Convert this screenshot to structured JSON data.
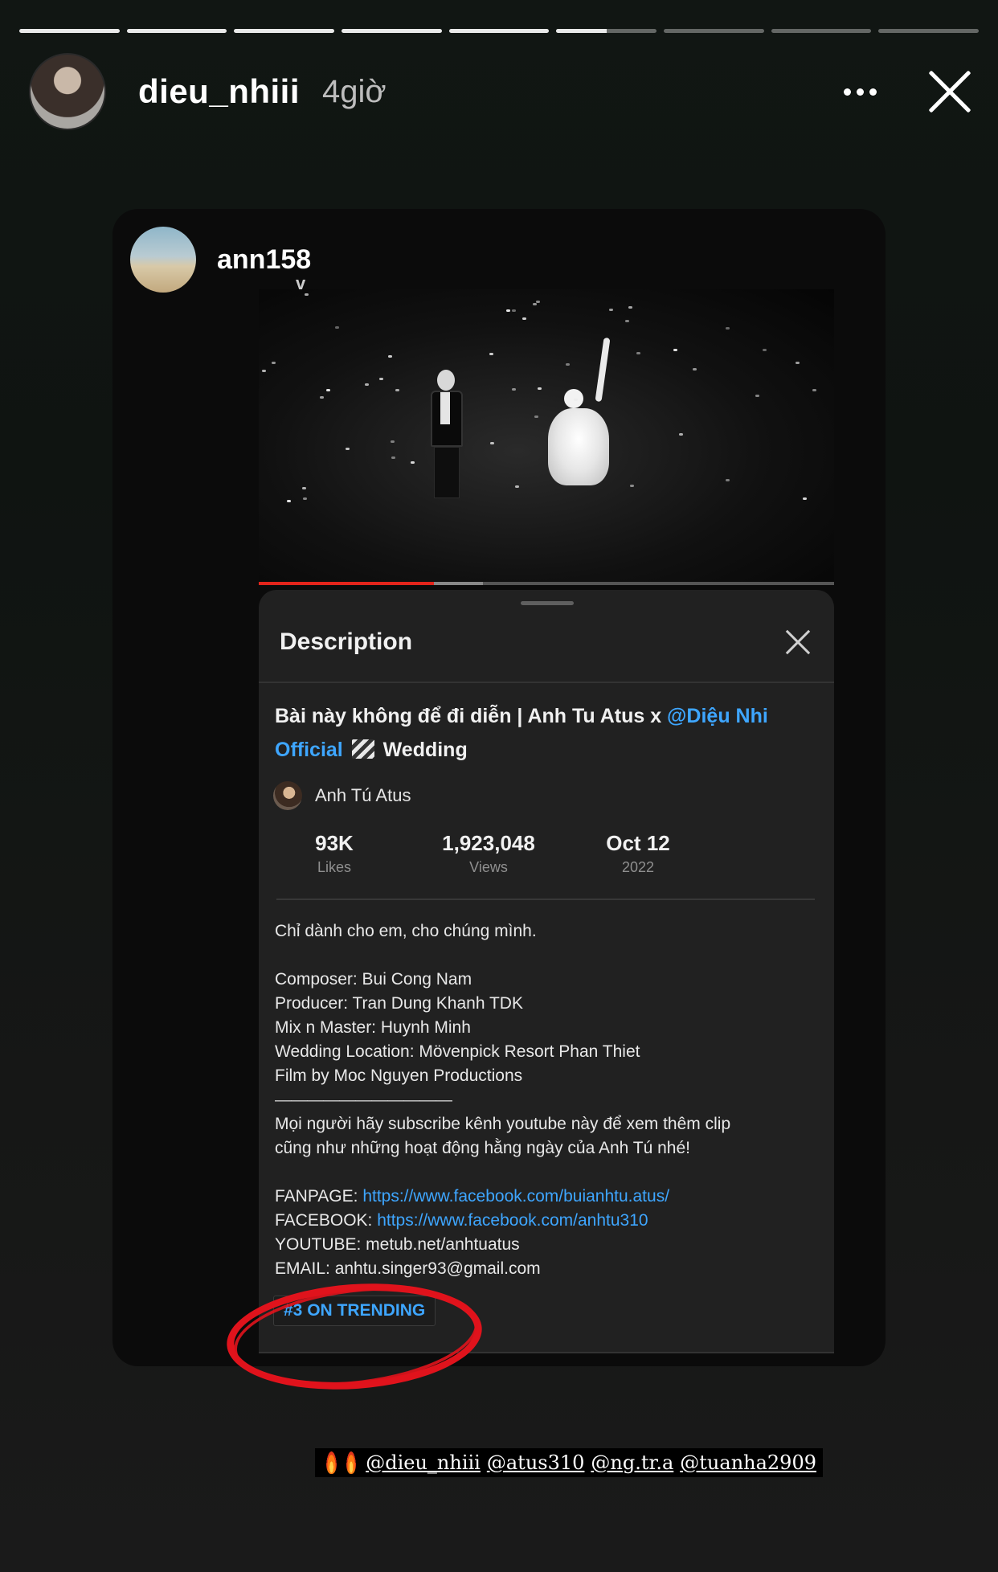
{
  "story": {
    "segments_total": 9,
    "segments_viewed": 5,
    "current_segment_progress": 0.5,
    "username": "dieu_nhiii",
    "time_ago": "4giờ",
    "more_icon": "more-horizontal-icon",
    "close_icon": "close-icon"
  },
  "shared_post": {
    "username": "ann158",
    "video": {
      "progress_played": 0.305,
      "progress_buffered": 0.39
    },
    "description_sheet": {
      "title": "Description",
      "video_title_part1": "Bài này không để đi diễn | Anh Tu Atus x ",
      "video_title_mention": "@Diệu Nhi Official",
      "video_title_part2": " Wedding",
      "channel_name": "Anh Tú Atus",
      "stats": [
        {
          "value": "93K",
          "label": "Likes"
        },
        {
          "value": "1,923,048",
          "label": "Views"
        },
        {
          "value": "Oct 12",
          "label": "2022"
        }
      ],
      "body_lines": {
        "intro": "Chỉ dành cho em, cho chúng mình.",
        "composer": "Composer: Bui Cong Nam",
        "producer": "Producer: Tran Dung Khanh TDK",
        "mix": "Mix n Master: Huynh Minh",
        "location": "Wedding Location: Mövenpick Resort Phan Thiet",
        "film": "Film by Moc Nguyen Productions",
        "separator": "———————————",
        "subscribe1": "Mọi người hãy subscribe kênh youtube này để xem thêm clip",
        "subscribe2": "cũng như những hoạt động hằng ngày của Anh Tú nhé!",
        "fanpage_label": "FANPAGE: ",
        "fanpage_url": "https://www.facebook.com/buianhtu.atus/",
        "facebook_label": "FACEBOOK: ",
        "facebook_url": "https://www.facebook.com/anhtu310",
        "youtube": "YOUTUBE: metub.net/anhtuatus",
        "email": "EMAIL: anhtu.singer93@gmail.com"
      },
      "trending_tag": "#3 ON TRENDING"
    }
  },
  "annotation": {
    "circle_color": "#e0131c"
  },
  "mentions_sticker": {
    "mentions": [
      "@dieu_nhiii",
      "@atus310",
      "@ng.tr.a",
      "@tuanha2909"
    ]
  },
  "colors": {
    "link_blue": "#3ea6ff",
    "progress_red": "#e3241b",
    "sheet_bg": "#212121"
  }
}
